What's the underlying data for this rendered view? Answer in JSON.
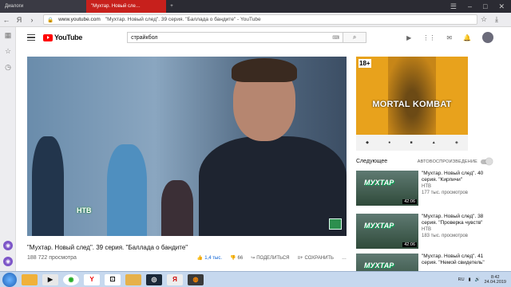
{
  "browser": {
    "tabs": [
      {
        "label": "Диалоги"
      },
      {
        "label": "\"Мухтар. Новый сле…"
      }
    ],
    "new_tab": "+",
    "address": {
      "domain": "www.youtube.com",
      "page_title": "\"Мухтар. Новый след\". 39 серия. \"Баллада о бандите\" - YouTube"
    }
  },
  "youtube": {
    "logo": "YouTube",
    "search_value": "страйкбол",
    "video": {
      "channel_logo": "НТВ",
      "title": "\"Мухтар. Новый след\". 39 серия. \"Баллада о бандите\"",
      "views": "188 722 просмотра",
      "likes": "1,4 тыс.",
      "dislikes": "66",
      "share": "ПОДЕЛИТЬСЯ",
      "save": "СОХРАНИТЬ",
      "more": "…"
    },
    "ad": {
      "rating": "18+",
      "brand": "MORTAL KOMBAT"
    },
    "up_next": "Следующее",
    "autoplay": "АВТОВОСПРОИЗВЕДЕНИЕ",
    "recommendations": [
      {
        "title": "\"Мухтар. Новый след\". 40 серия. \"Кирпичи\"",
        "channel": "НТВ",
        "views": "177 тыс. просмотров",
        "duration": "42:06",
        "thumb_text": "МУХТАР"
      },
      {
        "title": "\"Мухтар. Новый след\". 38 серия. \"Проверка чувств\"",
        "channel": "НТВ",
        "views": "183 тыс. просмотров",
        "duration": "42:06",
        "thumb_text": "МУХТАР"
      },
      {
        "title": "\"Мухтар. Новый след\". 41 серия. \"Немой свидетель\"",
        "channel": "НТВ",
        "views": "",
        "duration": "",
        "thumb_text": "МУХТАР"
      }
    ]
  },
  "taskbar": {
    "lang": "RU",
    "time": "8:42",
    "date": "24.04.2019"
  }
}
